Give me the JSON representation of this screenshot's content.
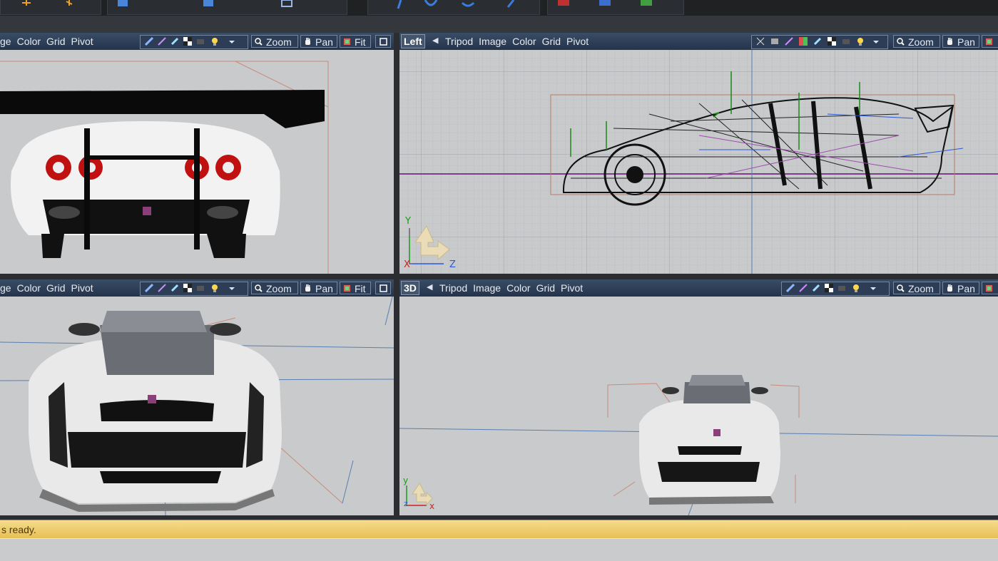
{
  "viewports": {
    "top_left": {
      "menu": [
        "ge",
        "Color",
        "Grid",
        "Pivot"
      ],
      "buttons": {
        "zoom": "Zoom",
        "pan": "Pan",
        "fit": "Fit"
      }
    },
    "top_right": {
      "name": "Left",
      "menu": [
        "Tripod",
        "Image",
        "Color",
        "Grid",
        "Pivot"
      ],
      "buttons": {
        "zoom": "Zoom",
        "pan": "Pan"
      },
      "axes": {
        "y": "Y",
        "x": "X",
        "z": "Z"
      }
    },
    "bottom_left": {
      "menu": [
        "ge",
        "Color",
        "Grid",
        "Pivot"
      ],
      "buttons": {
        "zoom": "Zoom",
        "pan": "Pan",
        "fit": "Fit"
      }
    },
    "bottom_right": {
      "name": "3D",
      "menu": [
        "Tripod",
        "Image",
        "Color",
        "Grid",
        "Pivot"
      ],
      "buttons": {
        "zoom": "Zoom",
        "pan": "Pan"
      },
      "axes": {
        "y": "y",
        "z": "z",
        "x": "x"
      }
    }
  },
  "status": {
    "text": "s ready."
  },
  "icons": [
    "magnifier-icon",
    "hand-icon",
    "fit-icon",
    "maximize-icon",
    "light-bulb-icon",
    "checker-icon",
    "brush-icon",
    "wrench-icon"
  ],
  "colors": {
    "bar_top": "#3a4c66",
    "bar_bottom": "#24344b",
    "status": "#e8bf55",
    "viewport_bg": "#c6c8ca",
    "axis_y": "#1a9a1a",
    "axis_x": "#d42020",
    "axis_z": "#2a5ad8"
  }
}
